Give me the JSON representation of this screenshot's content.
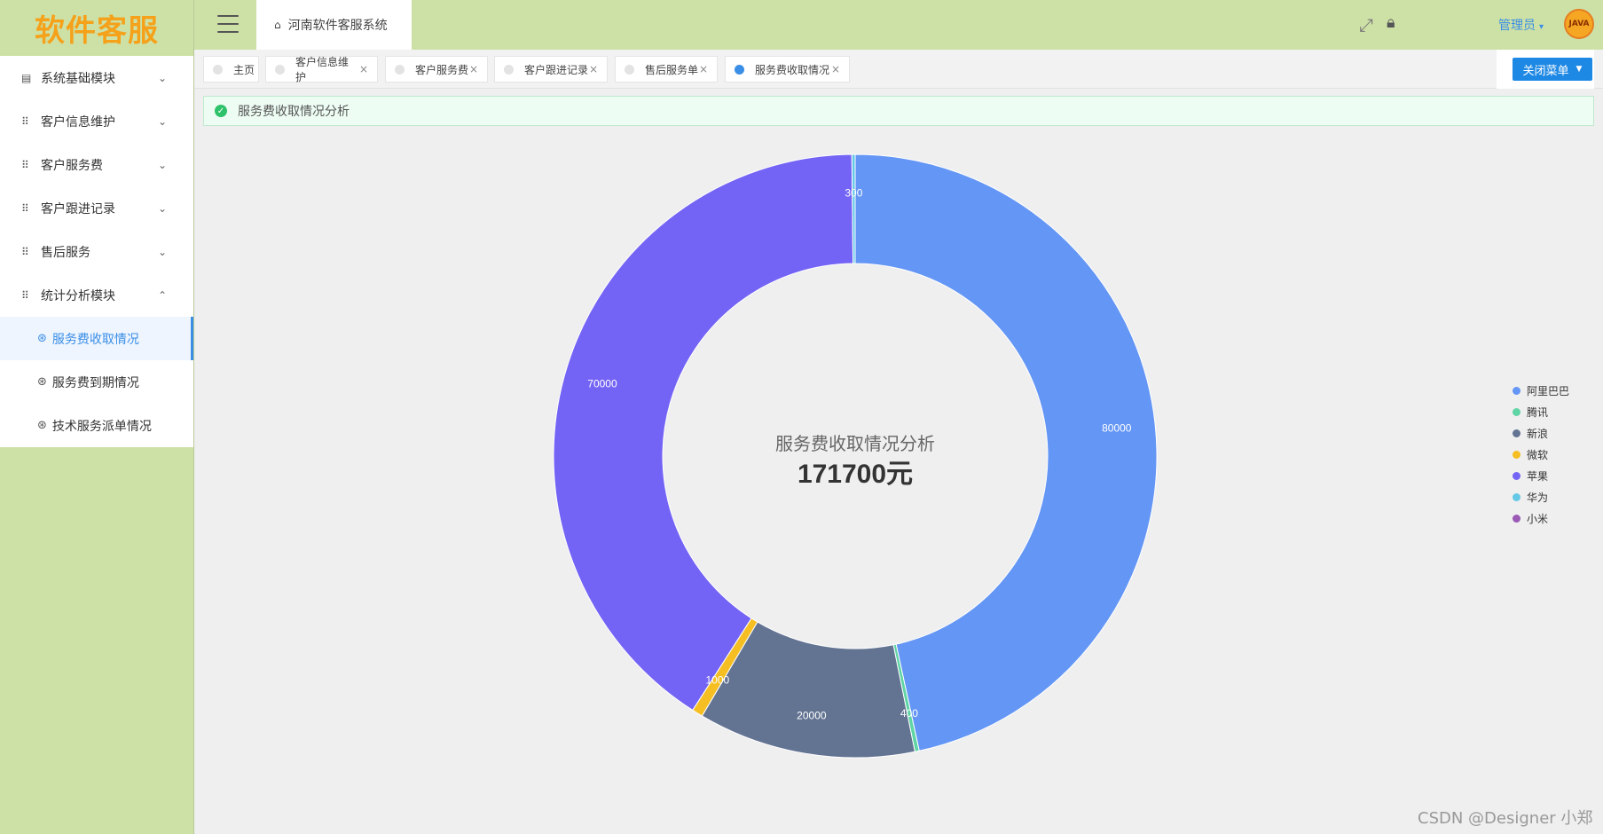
{
  "logo": "软件客服",
  "sidebar": {
    "items": [
      {
        "label": "系统基础模块",
        "arrow": "⌄"
      },
      {
        "label": "客户信息维护",
        "arrow": "⌄"
      },
      {
        "label": "客户服务费",
        "arrow": "⌄"
      },
      {
        "label": "客户跟进记录",
        "arrow": "⌄"
      },
      {
        "label": "售后服务",
        "arrow": "⌄"
      },
      {
        "label": "统计分析模块",
        "arrow": "⌃"
      }
    ],
    "sub_items": [
      {
        "label": "服务费收取情况"
      },
      {
        "label": "服务费到期情况"
      },
      {
        "label": "技术服务派单情况"
      }
    ]
  },
  "header": {
    "home_tab": "河南软件客服系统",
    "user": "管理员",
    "avatar_text": "JAVA"
  },
  "tabs": [
    {
      "label": "主页"
    },
    {
      "label": "客户信息维护"
    },
    {
      "label": "客户服务费"
    },
    {
      "label": "客户跟进记录"
    },
    {
      "label": "售后服务单"
    },
    {
      "label": "服务费收取情况"
    }
  ],
  "close_menu": "关闭菜单",
  "notice": "服务费收取情况分析",
  "chart_data": {
    "type": "pie",
    "center_title": "服务费收取情况分析",
    "center_total": "171700元",
    "slices": [
      {
        "name": "阿里巴巴",
        "value": 80000,
        "color": "#6496f5"
      },
      {
        "name": "腾讯",
        "value": 400,
        "color": "#5fd4a5"
      },
      {
        "name": "新浪",
        "value": 20000,
        "color": "#637493"
      },
      {
        "name": "微软",
        "value": 1000,
        "color": "#f5be22"
      },
      {
        "name": "苹果",
        "value": 70000,
        "color": "#7464f5"
      },
      {
        "name": "华为",
        "value": 300,
        "color": "#64c8e6"
      },
      {
        "name": "小米",
        "value": 0,
        "color": "#9b59b6"
      }
    ],
    "legend_position": "right"
  },
  "watermark": "CSDN @Designer 小郑"
}
